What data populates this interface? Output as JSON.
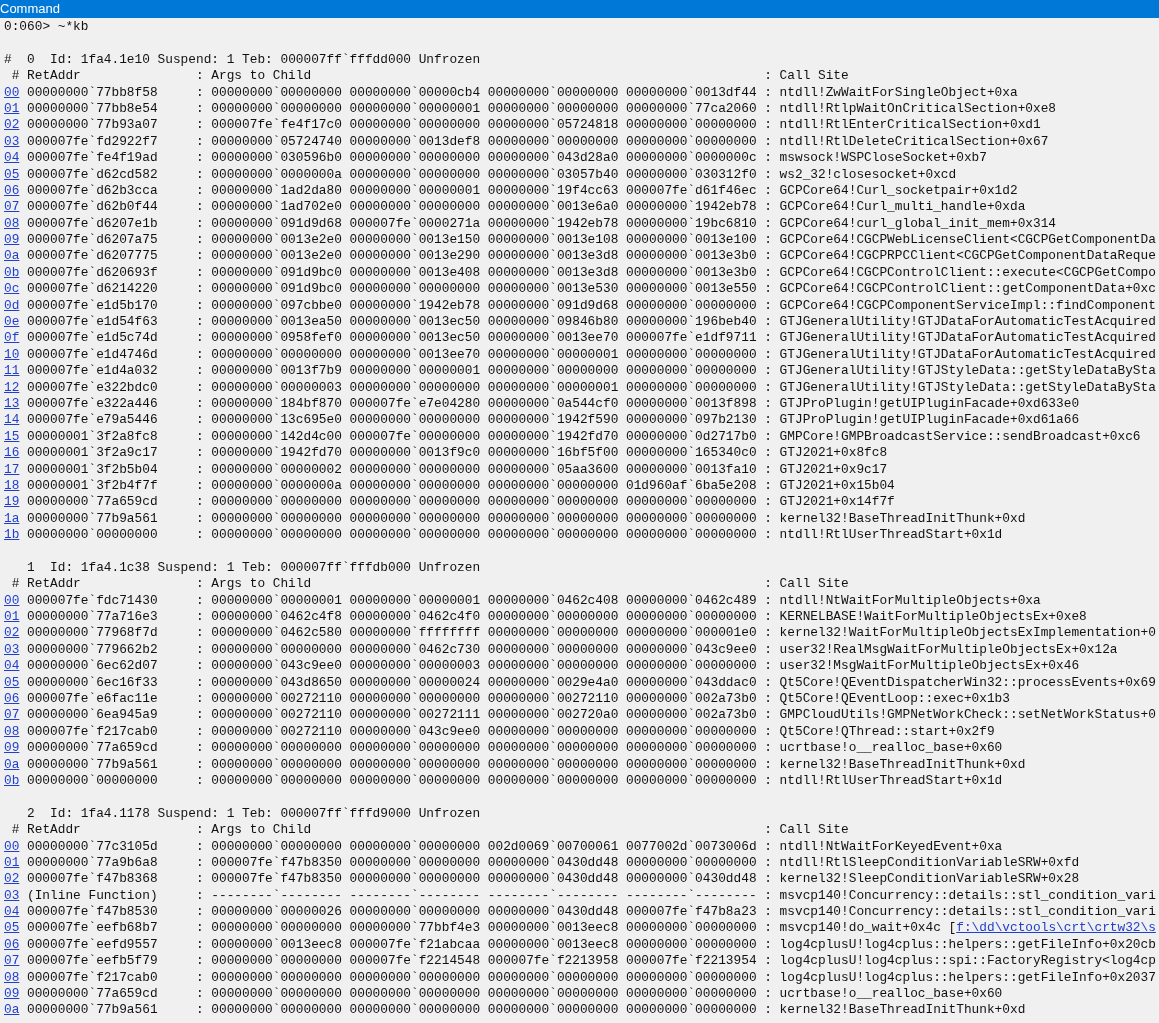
{
  "window": {
    "title": "Command"
  },
  "command": "0:060> ~*kb",
  "threads": [
    {
      "marker": "#",
      "header": "0  Id: 1fa4.1e10 Suspend: 1 Teb: 000007ff`fffdd000 Unfrozen",
      "columns": [
        "# RetAddr",
        ": Args to Child",
        ": Call Site"
      ],
      "frames": [
        {
          "frame": "00",
          "text": "00000000`77bb8f58     : 00000000`00000000 00000000`00000cb4 00000000`00000000 00000000`0013df44 : ntdll!ZwWaitForSingleObject+0xa"
        },
        {
          "frame": "01",
          "text": "00000000`77bb8e54     : 00000000`00000000 00000000`00000001 00000000`00000000 00000000`77ca2060 : ntdll!RtlpWaitOnCriticalSection+0xe8"
        },
        {
          "frame": "02",
          "text": "00000000`77b93a07     : 000007fe`fe4f17c0 00000000`00000000 00000000`05724818 00000000`00000000 : ntdll!RtlEnterCriticalSection+0xd1"
        },
        {
          "frame": "03",
          "text": "000007fe`fd2922f7     : 00000000`05724740 00000000`0013def8 00000000`00000000 00000000`00000000 : ntdll!RtlDeleteCriticalSection+0x67"
        },
        {
          "frame": "04",
          "text": "000007fe`fe4f19ad     : 00000000`030596b0 00000000`00000000 00000000`043d28a0 00000000`0000000c : mswsock!WSPCloseSocket+0xb7"
        },
        {
          "frame": "05",
          "text": "000007fe`d62cd582     : 00000000`0000000a 00000000`00000000 00000000`03057b40 00000000`030312f0 : ws2_32!closesocket+0xcd"
        },
        {
          "frame": "06",
          "text": "000007fe`d62b3cca     : 00000000`1ad2da80 00000000`00000001 00000000`19f4cc63 000007fe`d61f46ec : GCPCore64!Curl_socketpair+0x1d2"
        },
        {
          "frame": "07",
          "text": "000007fe`d62b0f44     : 00000000`1ad702e0 00000000`00000000 00000000`0013e6a0 00000000`1942eb78 : GCPCore64!Curl_multi_handle+0xda"
        },
        {
          "frame": "08",
          "text": "000007fe`d6207e1b     : 00000000`091d9d68 000007fe`0000271a 00000000`1942eb78 00000000`19bc6810 : GCPCore64!curl_global_init_mem+0x314"
        },
        {
          "frame": "09",
          "text": "000007fe`d6207a75     : 00000000`0013e2e0 00000000`0013e150 00000000`0013e108 00000000`0013e100 : GCPCore64!CGCPWebLicenseClient<CGCPGetComponentDa"
        },
        {
          "frame": "0a",
          "text": "000007fe`d6207775     : 00000000`0013e2e0 00000000`0013e290 00000000`0013e3d8 00000000`0013e3b0 : GCPCore64!CGCPRPCClient<CGCPGetComponentDataReque"
        },
        {
          "frame": "0b",
          "text": "000007fe`d620693f     : 00000000`091d9bc0 00000000`0013e408 00000000`0013e3d8 00000000`0013e3b0 : GCPCore64!CGCPControlClient::execute<CGCPGetCompo"
        },
        {
          "frame": "0c",
          "text": "000007fe`d6214220     : 00000000`091d9bc0 00000000`00000000 00000000`0013e530 00000000`0013e550 : GCPCore64!CGCPControlClient::getComponentData+0xc"
        },
        {
          "frame": "0d",
          "text": "000007fe`e1d5b170     : 00000000`097cbbe0 00000000`1942eb78 00000000`091d9d68 00000000`00000000 : GCPCore64!CGCPComponentServiceImpl::findComponent"
        },
        {
          "frame": "0e",
          "text": "000007fe`e1d54f63     : 00000000`0013ea50 00000000`0013ec50 00000000`09846b80 00000000`196beb40 : GTJGeneralUtility!GTJDataForAutomaticTestAcquired"
        },
        {
          "frame": "0f",
          "text": "000007fe`e1d5c74d     : 00000000`0958fef0 00000000`0013ec50 00000000`0013ee70 000007fe`e1df9711 : GTJGeneralUtility!GTJDataForAutomaticTestAcquired"
        },
        {
          "frame": "10",
          "text": "000007fe`e1d4746d     : 00000000`00000000 00000000`0013ee70 00000000`00000001 00000000`00000000 : GTJGeneralUtility!GTJDataForAutomaticTestAcquired"
        },
        {
          "frame": "11",
          "text": "000007fe`e1d4a032     : 00000000`0013f7b9 00000000`00000001 00000000`00000000 00000000`00000000 : GTJGeneralUtility!GTJStyleData::getStyleDataBySta"
        },
        {
          "frame": "12",
          "text": "000007fe`e322bdc0     : 00000000`00000003 00000000`00000000 00000000`00000001 00000000`00000000 : GTJGeneralUtility!GTJStyleData::getStyleDataBySta"
        },
        {
          "frame": "13",
          "text": "000007fe`e322a446     : 00000000`184bf870 000007fe`e7e04280 00000000`0a544cf0 00000000`0013f898 : GTJProPlugin!getUIPluginFacade+0xd633e0"
        },
        {
          "frame": "14",
          "text": "000007fe`e79a5446     : 00000000`13c695e0 00000000`00000000 00000000`1942f590 00000000`097b2130 : GTJProPlugin!getUIPluginFacade+0xd61a66"
        },
        {
          "frame": "15",
          "text": "00000001`3f2a8fc8     : 00000000`142d4c00 000007fe`00000000 00000000`1942fd70 00000000`0d2717b0 : GMPCore!GMPBroadcastService::sendBroadcast+0xc6"
        },
        {
          "frame": "16",
          "text": "00000001`3f2a9c17     : 00000000`1942fd70 00000000`0013f9c0 00000000`16bf5f00 00000000`165340c0 : GTJ2021+0x8fc8"
        },
        {
          "frame": "17",
          "text": "00000001`3f2b5b04     : 00000000`00000002 00000000`00000000 00000000`05aa3600 00000000`0013fa10 : GTJ2021+0x9c17"
        },
        {
          "frame": "18",
          "text": "00000001`3f2b4f7f     : 00000000`0000000a 00000000`00000000 00000000`00000000 01d960af`6ba5e208 : GTJ2021+0x15b04"
        },
        {
          "frame": "19",
          "text": "00000000`77a659cd     : 00000000`00000000 00000000`00000000 00000000`00000000 00000000`00000000 : GTJ2021+0x14f7f"
        },
        {
          "frame": "1a",
          "text": "00000000`77b9a561     : 00000000`00000000 00000000`00000000 00000000`00000000 00000000`00000000 : kernel32!BaseThreadInitThunk+0xd"
        },
        {
          "frame": "1b",
          "text": "00000000`00000000     : 00000000`00000000 00000000`00000000 00000000`00000000 00000000`00000000 : ntdll!RtlUserThreadStart+0x1d"
        }
      ]
    },
    {
      "header": "1  Id: 1fa4.1c38 Suspend: 1 Teb: 000007ff`fffdb000 Unfrozen",
      "columns": [
        "# RetAddr",
        ": Args to Child",
        ": Call Site"
      ],
      "frames": [
        {
          "frame": "00",
          "text": "000007fe`fdc71430     : 00000000`00000001 00000000`00000001 00000000`0462c408 00000000`0462c489 : ntdll!NtWaitForMultipleObjects+0xa"
        },
        {
          "frame": "01",
          "text": "00000000`77a716e3     : 00000000`0462c4f8 00000000`0462c4f0 00000000`00000000 00000000`00000000 : KERNELBASE!WaitForMultipleObjectsEx+0xe8"
        },
        {
          "frame": "02",
          "text": "00000000`77968f7d     : 00000000`0462c580 00000000`ffffffff 00000000`00000000 00000000`000001e0 : kernel32!WaitForMultipleObjectsExImplementation+0"
        },
        {
          "frame": "03",
          "text": "00000000`779662b2     : 00000000`00000000 00000000`0462c730 00000000`00000000 00000000`043c9ee0 : user32!RealMsgWaitForMultipleObjectsEx+0x12a"
        },
        {
          "frame": "04",
          "text": "00000000`6ec62d07     : 00000000`043c9ee0 00000000`00000003 00000000`00000000 00000000`00000000 : user32!MsgWaitForMultipleObjectsEx+0x46"
        },
        {
          "frame": "05",
          "text": "00000000`6ec16f33     : 00000000`043d8650 00000000`00000024 00000000`0029e4a0 00000000`043ddac0 : Qt5Core!QEventDispatcherWin32::processEvents+0x69"
        },
        {
          "frame": "06",
          "text": "000007fe`e6fac11e     : 00000000`00272110 00000000`00000000 00000000`00272110 00000000`002a73b0 : Qt5Core!QEventLoop::exec+0x1b3"
        },
        {
          "frame": "07",
          "text": "00000000`6ea945a9     : 00000000`00272110 00000000`00272111 00000000`002720a0 00000000`002a73b0 : GMPCloudUtils!GMPNetWorkCheck::setNetWorkStatus+0"
        },
        {
          "frame": "08",
          "text": "000007fe`f217cab0     : 00000000`00272110 00000000`043c9ee0 00000000`00000000 00000000`00000000 : Qt5Core!QThread::start+0x2f9"
        },
        {
          "frame": "09",
          "text": "00000000`77a659cd     : 00000000`00000000 00000000`00000000 00000000`00000000 00000000`00000000 : ucrtbase!o__realloc_base+0x60"
        },
        {
          "frame": "0a",
          "text": "00000000`77b9a561     : 00000000`00000000 00000000`00000000 00000000`00000000 00000000`00000000 : kernel32!BaseThreadInitThunk+0xd"
        },
        {
          "frame": "0b",
          "text": "00000000`00000000     : 00000000`00000000 00000000`00000000 00000000`00000000 00000000`00000000 : ntdll!RtlUserThreadStart+0x1d"
        }
      ]
    },
    {
      "header": "2  Id: 1fa4.1178 Suspend: 1 Teb: 000007ff`fffd9000 Unfrozen",
      "columns": [
        "# RetAddr",
        ": Args to Child",
        ": Call Site"
      ],
      "frames": [
        {
          "frame": "00",
          "text": "00000000`77c3105d     : 00000000`00000000 00000000`00000000 002d0069`00700061 0077002d`0073006d : ntdll!NtWaitForKeyedEvent+0xa"
        },
        {
          "frame": "01",
          "text": "00000000`77a9b6a8     : 000007fe`f47b8350 00000000`00000000 00000000`0430dd48 00000000`00000000 : ntdll!RtlSleepConditionVariableSRW+0xfd"
        },
        {
          "frame": "02",
          "text": "000007fe`f47b8368     : 000007fe`f47b8350 00000000`00000000 00000000`0430dd48 00000000`0430dd48 : kernel32!SleepConditionVariableSRW+0x28"
        },
        {
          "frame": "03",
          "text": "(Inline Function)     : --------`-------- --------`-------- --------`-------- --------`-------- : msvcp140!Concurrency::details::stl_condition_vari"
        },
        {
          "frame": "04",
          "text": "000007fe`f47b8530     : 00000000`00000026 00000000`00000000 00000000`0430dd48 000007fe`f47b8a23 : msvcp140!Concurrency::details::stl_condition_vari"
        },
        {
          "frame": "05",
          "text": "000007fe`eefb68b7     : 00000000`00000000 00000000`77bbf4e3 00000000`0013eec8 00000000`00000000 : msvcp140!do_wait+0x4c [",
          "source_link": "f:\\dd\\vctools\\crt\\crtw32\\s"
        },
        {
          "frame": "06",
          "text": "000007fe`eefd9557     : 00000000`0013eec8 000007fe`f21abcaa 00000000`0013eec8 00000000`00000000 : log4cplusU!log4cplus::helpers::getFileInfo+0x20cb"
        },
        {
          "frame": "07",
          "text": "000007fe`eefb5f79     : 00000000`00000000 000007fe`f2214548 000007fe`f2213958 000007fe`f2213954 : log4cplusU!log4cplus::spi::FactoryRegistry<log4cp"
        },
        {
          "frame": "08",
          "text": "000007fe`f217cab0     : 00000000`00000000 00000000`00000000 00000000`00000000 00000000`00000000 : log4cplusU!log4cplus::helpers::getFileInfo+0x2037"
        },
        {
          "frame": "09",
          "text": "00000000`77a659cd     : 00000000`00000000 00000000`00000000 00000000`00000000 00000000`00000000 : ucrtbase!o__realloc_base+0x60"
        },
        {
          "frame": "0a",
          "text": "00000000`77b9a561     : 00000000`00000000 00000000`00000000 00000000`00000000 00000000`00000000 : kernel32!BaseThreadInitThunk+0xd"
        }
      ]
    }
  ]
}
